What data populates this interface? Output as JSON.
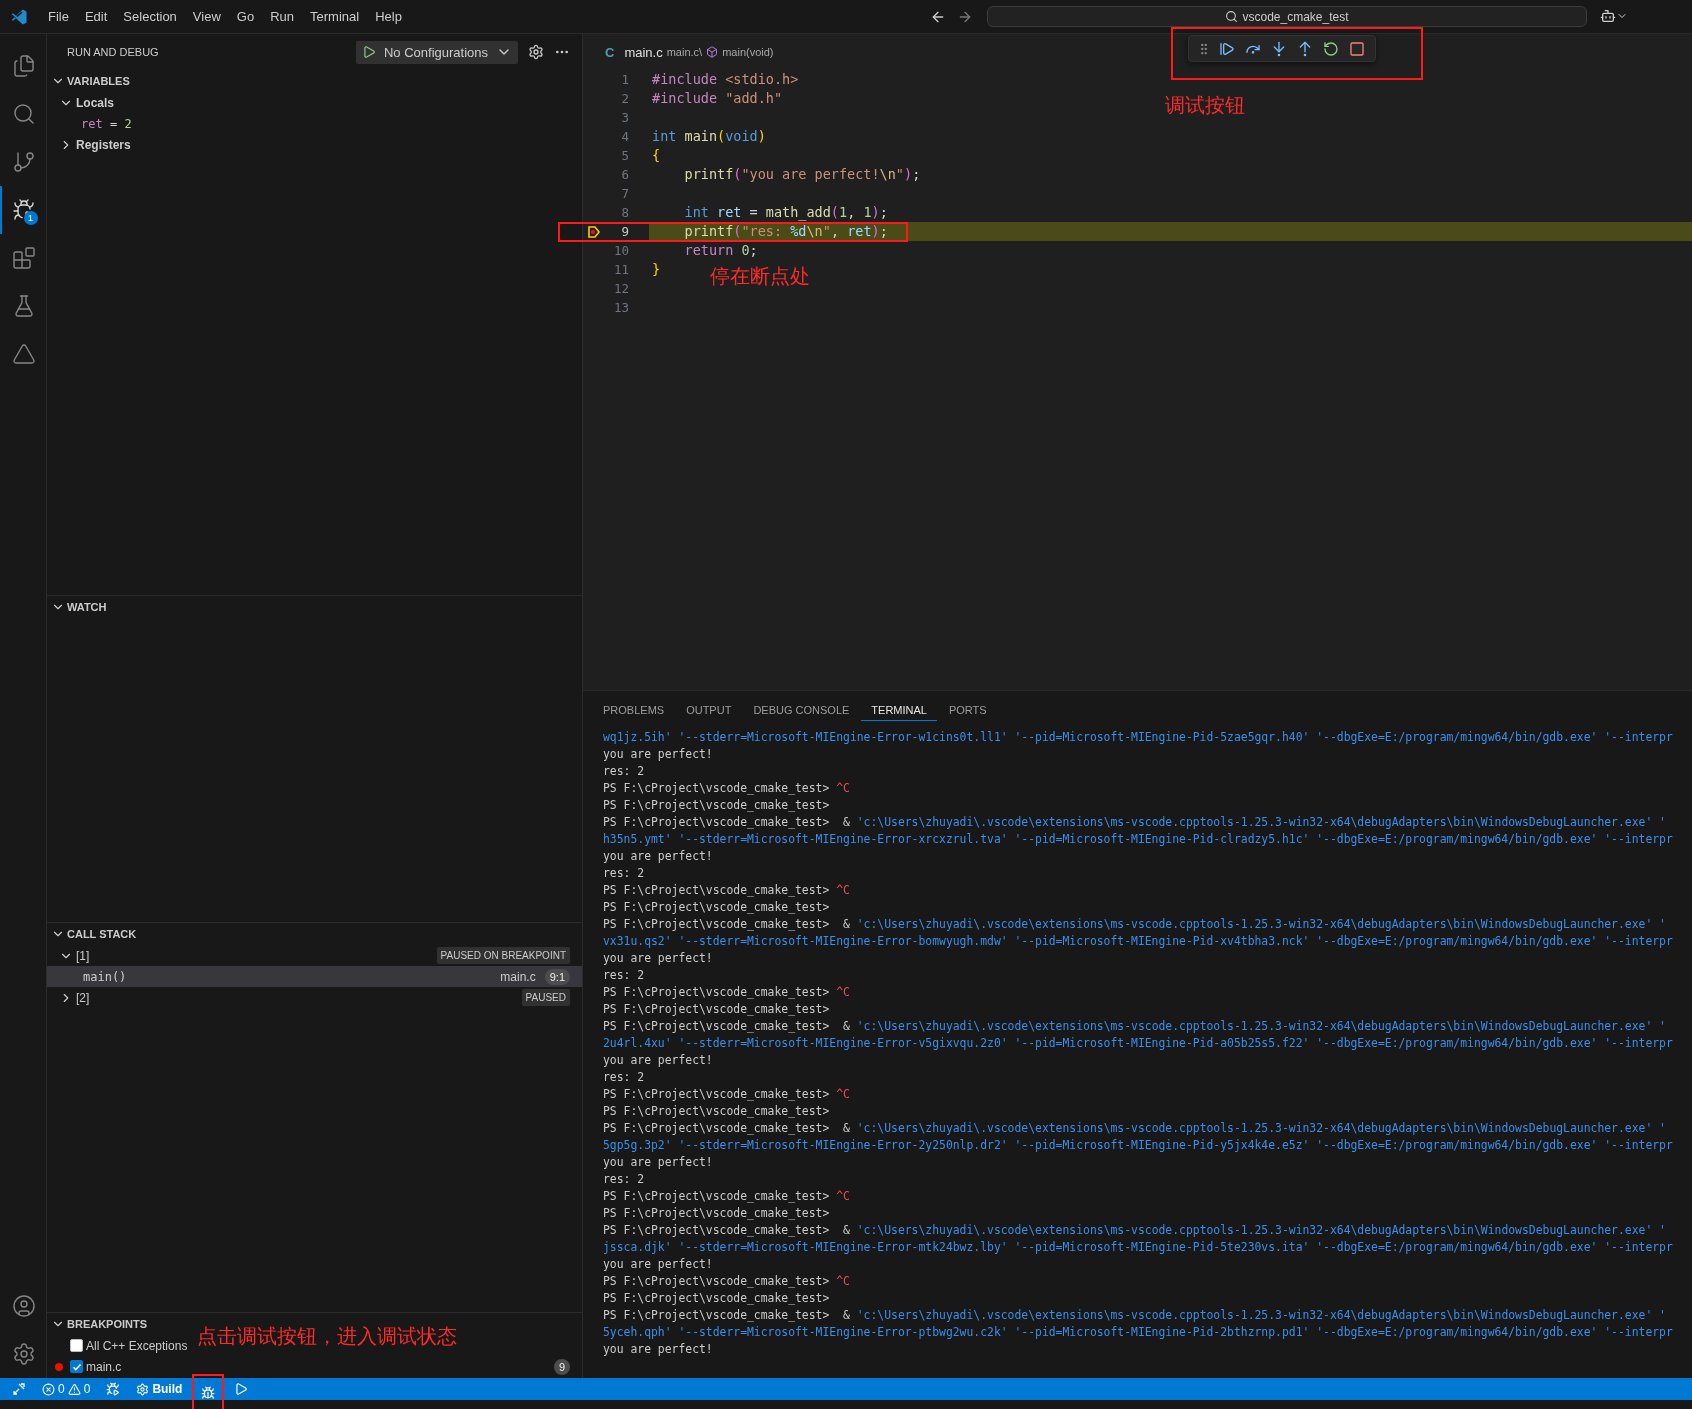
{
  "menu": [
    "File",
    "Edit",
    "Selection",
    "View",
    "Go",
    "Run",
    "Terminal",
    "Help"
  ],
  "command_center": {
    "text": "vscode_cmake_test"
  },
  "activity_bar": [
    {
      "kind": "explorer",
      "selected": false
    },
    {
      "kind": "search",
      "selected": false
    },
    {
      "kind": "scm",
      "selected": false
    },
    {
      "kind": "debug",
      "selected": true,
      "badge": "1"
    },
    {
      "kind": "extensions",
      "selected": false
    },
    {
      "kind": "testing",
      "selected": false
    },
    {
      "kind": "cmake",
      "selected": false
    }
  ],
  "activity_bottom": [
    {
      "kind": "account"
    },
    {
      "kind": "manage"
    }
  ],
  "sidebar": {
    "title": "RUN AND DEBUG",
    "config": "No Configurations",
    "variables": {
      "title": "VARIABLES",
      "expanded": true,
      "scopes": [
        {
          "label": "Locals",
          "expanded": true,
          "children": [
            {
              "name": "ret",
              "separator": "=",
              "value": "2"
            }
          ]
        },
        {
          "label": "Registers",
          "expanded": false
        }
      ]
    },
    "watch": {
      "title": "WATCH",
      "expanded": true
    },
    "call_stack": {
      "title": "CALL STACK",
      "expanded": true,
      "threads": [
        {
          "label": "[1]",
          "expanded": true,
          "status": "PAUSED ON BREAKPOINT",
          "frames": [
            {
              "name": "main()",
              "file": "main.c",
              "position": "9:1",
              "selected": true
            }
          ]
        },
        {
          "label": "[2]",
          "expanded": false,
          "status": "PAUSED"
        }
      ]
    },
    "breakpoints": {
      "title": "BREAKPOINTS",
      "expanded": true,
      "items": [
        {
          "kind": "exception",
          "label": "All C++ Exceptions",
          "checked": false
        },
        {
          "kind": "file",
          "label": "main.c",
          "checked": true,
          "badge": "9"
        }
      ]
    }
  },
  "editor": {
    "breadcrumb": {
      "badge": "C",
      "file": "main.c",
      "path": "main.c\\",
      "symbol": "main(void)"
    },
    "debug_toolbar": {
      "marked": true,
      "buttons": [
        {
          "kind": "continue"
        },
        {
          "kind": "step_over"
        },
        {
          "kind": "step_into"
        },
        {
          "kind": "step_out"
        },
        {
          "kind": "restart"
        },
        {
          "kind": "stop"
        }
      ]
    },
    "lines": [
      {
        "number": "1",
        "current": false,
        "marked": false,
        "tokens": [
          {
            "kind": "pre",
            "text": "#include"
          },
          {
            "kind": "str",
            "text": " <stdio.h>"
          }
        ]
      },
      {
        "number": "2",
        "current": false,
        "marked": false,
        "tokens": [
          {
            "kind": "pre",
            "text": "#include"
          },
          {
            "kind": "str",
            "text": " \"add.h\""
          }
        ]
      },
      {
        "number": "3",
        "current": false,
        "marked": false
      },
      {
        "number": "4",
        "current": false,
        "marked": false,
        "tokens": [
          {
            "kind": "kw",
            "text": "int"
          },
          {
            "kind": "fn",
            "text": " main"
          },
          {
            "kind": "br1",
            "text": "("
          },
          {
            "kind": "kw",
            "text": "void"
          },
          {
            "kind": "br1",
            "text": ")"
          }
        ]
      },
      {
        "number": "5",
        "current": false,
        "marked": false,
        "tokens": [
          {
            "kind": "br1",
            "text": "{"
          }
        ]
      },
      {
        "number": "6",
        "current": false,
        "marked": false,
        "tokens": [
          {
            "kind": "fn",
            "text": "    printf"
          },
          {
            "kind": "br2",
            "text": "("
          },
          {
            "kind": "str",
            "text": "\"you are perfect!"
          },
          {
            "kind": "esc",
            "text": "\\n"
          },
          {
            "kind": "str",
            "text": "\""
          },
          {
            "kind": "br2",
            "text": ")"
          },
          {
            "kind": "p",
            "text": ";"
          }
        ]
      },
      {
        "number": "7",
        "current": false,
        "marked": false
      },
      {
        "number": "8",
        "current": false,
        "marked": false,
        "tokens": [
          {
            "kind": "kw",
            "text": "    int"
          },
          {
            "kind": "var",
            "text": " ret"
          },
          {
            "kind": "p",
            "text": " = "
          },
          {
            "kind": "fn",
            "text": "math_add"
          },
          {
            "kind": "br2",
            "text": "("
          },
          {
            "kind": "num",
            "text": "1"
          },
          {
            "kind": "p",
            "text": ", "
          },
          {
            "kind": "num",
            "text": "1"
          },
          {
            "kind": "br2",
            "text": ")"
          },
          {
            "kind": "p",
            "text": ";"
          }
        ]
      },
      {
        "number": "9",
        "current": true,
        "marked": true,
        "tokens": [
          {
            "kind": "fn",
            "text": "    printf"
          },
          {
            "kind": "br2",
            "text": "("
          },
          {
            "kind": "str",
            "text": "\"res: "
          },
          {
            "kind": "var",
            "text": "%d"
          },
          {
            "kind": "esc",
            "text": "\\n"
          },
          {
            "kind": "str",
            "text": "\""
          },
          {
            "kind": "p",
            "text": ", "
          },
          {
            "kind": "var",
            "text": "ret"
          },
          {
            "kind": "br2",
            "text": ")"
          },
          {
            "kind": "p",
            "text": ";"
          }
        ]
      },
      {
        "number": "10",
        "current": false,
        "marked": false,
        "tokens": [
          {
            "kind": "pre",
            "text": "    return"
          },
          {
            "kind": "num",
            "text": " 0"
          },
          {
            "kind": "p",
            "text": ";"
          }
        ]
      },
      {
        "number": "11",
        "current": false,
        "marked": false,
        "tokens": [
          {
            "kind": "br1",
            "text": "}"
          }
        ]
      },
      {
        "number": "12",
        "current": false,
        "marked": false
      },
      {
        "number": "13",
        "current": false,
        "marked": false
      }
    ]
  },
  "panel": {
    "tabs": [
      {
        "label": "PROBLEMS",
        "selected": false
      },
      {
        "label": "OUTPUT",
        "selected": false
      },
      {
        "label": "DEBUG CONSOLE",
        "selected": false
      },
      {
        "label": "TERMINAL",
        "selected": true
      },
      {
        "label": "PORTS",
        "selected": false
      }
    ],
    "terminal": [
      [
        {
          "kind": "arg",
          "text": "wq1jz.5ih' '--stderr=Microsoft-MIEngine-Error-w1cins0t.ll1' '--pid=Microsoft-MIEngine-Pid-5zae5gqr.h40' '--dbgExe=E:/program/mingw64/bin/gdb.exe' '--interpr"
        }
      ],
      [
        {
          "kind": "plain",
          "text": "you are perfect!"
        }
      ],
      [
        {
          "kind": "plain",
          "text": "res: 2"
        }
      ],
      [
        {
          "kind": "plain",
          "text": "PS F:\\cProject\\vscode_cmake_test> "
        },
        {
          "kind": "ctrl",
          "text": "^C"
        }
      ],
      [
        {
          "kind": "plain",
          "text": "PS F:\\cProject\\vscode_cmake_test>"
        }
      ],
      [
        {
          "kind": "plain",
          "text": "PS F:\\cProject\\vscode_cmake_test>  & "
        },
        {
          "kind": "arg",
          "text": "'c:\\Users\\zhuyadi\\.vscode\\extensions\\ms-vscode.cpptools-1.25.3-win32-x64\\debugAdapters\\bin\\WindowsDebugLauncher.exe' '"
        }
      ],
      [
        {
          "kind": "arg",
          "text": "h35n5.ymt' '--stderr=Microsoft-MIEngine-Error-xrcxzrul.tva' '--pid=Microsoft-MIEngine-Pid-clradzy5.h1c' '--dbgExe=E:/program/mingw64/bin/gdb.exe' '--interpr"
        }
      ],
      [
        {
          "kind": "plain",
          "text": "you are perfect!"
        }
      ],
      [
        {
          "kind": "plain",
          "text": "res: 2"
        }
      ],
      [
        {
          "kind": "plain",
          "text": "PS F:\\cProject\\vscode_cmake_test> "
        },
        {
          "kind": "ctrl",
          "text": "^C"
        }
      ],
      [
        {
          "kind": "plain",
          "text": "PS F:\\cProject\\vscode_cmake_test>"
        }
      ],
      [
        {
          "kind": "plain",
          "text": "PS F:\\cProject\\vscode_cmake_test>  & "
        },
        {
          "kind": "arg",
          "text": "'c:\\Users\\zhuyadi\\.vscode\\extensions\\ms-vscode.cpptools-1.25.3-win32-x64\\debugAdapters\\bin\\WindowsDebugLauncher.exe' '"
        }
      ],
      [
        {
          "kind": "arg",
          "text": "vx31u.qs2' '--stderr=Microsoft-MIEngine-Error-bomwyugh.mdw' '--pid=Microsoft-MIEngine-Pid-xv4tbha3.nck' '--dbgExe=E:/program/mingw64/bin/gdb.exe' '--interpr"
        }
      ],
      [
        {
          "kind": "plain",
          "text": "you are perfect!"
        }
      ],
      [
        {
          "kind": "plain",
          "text": "res: 2"
        }
      ],
      [
        {
          "kind": "plain",
          "text": "PS F:\\cProject\\vscode_cmake_test> "
        },
        {
          "kind": "ctrl",
          "text": "^C"
        }
      ],
      [
        {
          "kind": "plain",
          "text": "PS F:\\cProject\\vscode_cmake_test>"
        }
      ],
      [
        {
          "kind": "plain",
          "text": "PS F:\\cProject\\vscode_cmake_test>  & "
        },
        {
          "kind": "arg",
          "text": "'c:\\Users\\zhuyadi\\.vscode\\extensions\\ms-vscode.cpptools-1.25.3-win32-x64\\debugAdapters\\bin\\WindowsDebugLauncher.exe' '"
        }
      ],
      [
        {
          "kind": "arg",
          "text": "2u4rl.4xu' '--stderr=Microsoft-MIEngine-Error-v5gixvqu.2z0' '--pid=Microsoft-MIEngine-Pid-a05b25s5.f22' '--dbgExe=E:/program/mingw64/bin/gdb.exe' '--interpr"
        }
      ],
      [
        {
          "kind": "plain",
          "text": "you are perfect!"
        }
      ],
      [
        {
          "kind": "plain",
          "text": "res: 2"
        }
      ],
      [
        {
          "kind": "plain",
          "text": "PS F:\\cProject\\vscode_cmake_test> "
        },
        {
          "kind": "ctrl",
          "text": "^C"
        }
      ],
      [
        {
          "kind": "plain",
          "text": "PS F:\\cProject\\vscode_cmake_test>"
        }
      ],
      [
        {
          "kind": "plain",
          "text": "PS F:\\cProject\\vscode_cmake_test>  & "
        },
        {
          "kind": "arg",
          "text": "'c:\\Users\\zhuyadi\\.vscode\\extensions\\ms-vscode.cpptools-1.25.3-win32-x64\\debugAdapters\\bin\\WindowsDebugLauncher.exe' '"
        }
      ],
      [
        {
          "kind": "arg",
          "text": "5gp5g.3p2' '--stderr=Microsoft-MIEngine-Error-2y250nlp.dr2' '--pid=Microsoft-MIEngine-Pid-y5jx4k4e.e5z' '--dbgExe=E:/program/mingw64/bin/gdb.exe' '--interpr"
        }
      ],
      [
        {
          "kind": "plain",
          "text": "you are perfect!"
        }
      ],
      [
        {
          "kind": "plain",
          "text": "res: 2"
        }
      ],
      [
        {
          "kind": "plain",
          "text": "PS F:\\cProject\\vscode_cmake_test> "
        },
        {
          "kind": "ctrl",
          "text": "^C"
        }
      ],
      [
        {
          "kind": "plain",
          "text": "PS F:\\cProject\\vscode_cmake_test>"
        }
      ],
      [
        {
          "kind": "plain",
          "text": "PS F:\\cProject\\vscode_cmake_test>  & "
        },
        {
          "kind": "arg",
          "text": "'c:\\Users\\zhuyadi\\.vscode\\extensions\\ms-vscode.cpptools-1.25.3-win32-x64\\debugAdapters\\bin\\WindowsDebugLauncher.exe' '"
        }
      ],
      [
        {
          "kind": "arg",
          "text": "jssca.djk' '--stderr=Microsoft-MIEngine-Error-mtk24bwz.lby' '--pid=Microsoft-MIEngine-Pid-5te230vs.ita' '--dbgExe=E:/program/mingw64/bin/gdb.exe' '--interpr"
        }
      ],
      [
        {
          "kind": "plain",
          "text": "you are perfect!"
        }
      ],
      [
        {
          "kind": "plain",
          "text": "PS F:\\cProject\\vscode_cmake_test> "
        },
        {
          "kind": "ctrl",
          "text": "^C"
        }
      ],
      [
        {
          "kind": "plain",
          "text": "PS F:\\cProject\\vscode_cmake_test>"
        }
      ],
      [
        {
          "kind": "plain",
          "text": "PS F:\\cProject\\vscode_cmake_test>  & "
        },
        {
          "kind": "arg",
          "text": "'c:\\Users\\zhuyadi\\.vscode\\extensions\\ms-vscode.cpptools-1.25.3-win32-x64\\debugAdapters\\bin\\WindowsDebugLauncher.exe' '"
        }
      ],
      [
        {
          "kind": "arg",
          "text": "5yceh.qph' '--stderr=Microsoft-MIEngine-Error-ptbwg2wu.c2k' '--pid=Microsoft-MIEngine-Pid-2bthzrnp.pd1' '--dbgExe=E:/program/mingw64/bin/gdb.exe' '--interpr"
        }
      ],
      [
        {
          "kind": "plain",
          "text": "you are perfect!"
        }
      ]
    ]
  },
  "status_bar": {
    "items": [
      {
        "kind": "remote",
        "marked": false
      },
      {
        "kind": "problems",
        "errors": "0",
        "warnings": "0",
        "marked": false
      },
      {
        "kind": "launch",
        "marked": false
      },
      {
        "kind": "build",
        "label": "Build",
        "marked": false
      },
      {
        "kind": "debug",
        "marked": true
      },
      {
        "kind": "run",
        "marked": false
      }
    ]
  },
  "annotations": [
    {
      "text": "调试按钮"
    },
    {
      "text": "停在断点处"
    },
    {
      "text": "点击调试按钮，进入调试状态"
    }
  ]
}
